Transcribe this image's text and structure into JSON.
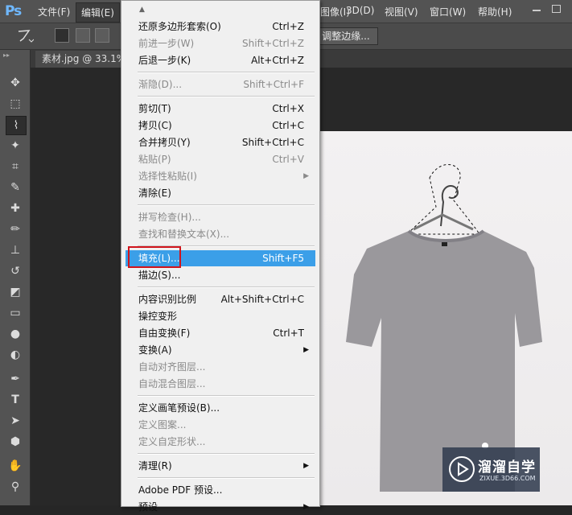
{
  "app": {
    "logo": "Ps"
  },
  "menubar": {
    "items": [
      "文件(F)",
      "编辑(E)",
      "图像(I)",
      "3D(D)",
      "视图(V)",
      "窗口(W)",
      "帮助(H)"
    ]
  },
  "options": {
    "refine_label": "调整边缘..."
  },
  "document": {
    "tab_label": "素材.jpg @ 33.1%"
  },
  "toolbar": {
    "tools": [
      "move-tool-icon",
      "marquee-tool-icon",
      "polygonal-lasso-tool-icon",
      "magic-wand-tool-icon",
      "crop-tool-icon",
      "eyedropper-tool-icon",
      "healing-brush-tool-icon",
      "brush-tool-icon",
      "clone-stamp-tool-icon",
      "history-brush-tool-icon",
      "eraser-tool-icon",
      "gradient-tool-icon",
      "blur-tool-icon",
      "dodge-tool-icon",
      "pen-tool-icon",
      "type-tool-icon",
      "path-selection-tool-icon",
      "shape-tool-icon",
      "hand-tool-icon",
      "zoom-tool-icon"
    ],
    "selected_tool": "polygonal-lasso-tool-icon"
  },
  "edit_menu": {
    "items": [
      {
        "label": "还原多边形套索(O)",
        "shortcut": "Ctrl+Z",
        "disabled": false
      },
      {
        "label": "前进一步(W)",
        "shortcut": "Shift+Ctrl+Z",
        "disabled": true
      },
      {
        "label": "后退一步(K)",
        "shortcut": "Alt+Ctrl+Z",
        "disabled": false
      },
      {
        "label": "渐隐(D)...",
        "shortcut": "Shift+Ctrl+F",
        "disabled": true
      },
      {
        "label": "剪切(T)",
        "shortcut": "Ctrl+X",
        "disabled": false
      },
      {
        "label": "拷贝(C)",
        "shortcut": "Ctrl+C",
        "disabled": false
      },
      {
        "label": "合并拷贝(Y)",
        "shortcut": "Shift+Ctrl+C",
        "disabled": false
      },
      {
        "label": "粘贴(P)",
        "shortcut": "Ctrl+V",
        "disabled": true
      },
      {
        "label": "选择性粘贴(I)",
        "shortcut": "",
        "disabled": true,
        "submenu": true
      },
      {
        "label": "清除(E)",
        "shortcut": "",
        "disabled": false
      },
      {
        "label": "拼写检查(H)...",
        "shortcut": "",
        "disabled": true
      },
      {
        "label": "查找和替换文本(X)...",
        "shortcut": "",
        "disabled": true
      },
      {
        "label": "填充(L)...",
        "shortcut": "Shift+F5",
        "disabled": false,
        "highlighted": true
      },
      {
        "label": "描边(S)...",
        "shortcut": "",
        "disabled": false
      },
      {
        "label": "内容识别比例",
        "shortcut": "Alt+Shift+Ctrl+C",
        "disabled": false
      },
      {
        "label": "操控变形",
        "shortcut": "",
        "disabled": false
      },
      {
        "label": "自由变换(F)",
        "shortcut": "Ctrl+T",
        "disabled": false
      },
      {
        "label": "变换(A)",
        "shortcut": "",
        "disabled": false,
        "submenu": true
      },
      {
        "label": "自动对齐图层...",
        "shortcut": "",
        "disabled": true
      },
      {
        "label": "自动混合图层...",
        "shortcut": "",
        "disabled": true
      },
      {
        "label": "定义画笔预设(B)...",
        "shortcut": "",
        "disabled": false
      },
      {
        "label": "定义图案...",
        "shortcut": "",
        "disabled": true
      },
      {
        "label": "定义自定形状...",
        "shortcut": "",
        "disabled": true
      },
      {
        "label": "清理(R)",
        "shortcut": "",
        "disabled": false,
        "submenu": true
      },
      {
        "label": "Adobe PDF 预设...",
        "shortcut": "",
        "disabled": false
      },
      {
        "label": "预设",
        "shortcut": "",
        "disabled": false,
        "submenu": true
      }
    ]
  },
  "watermark": {
    "title": "溜溜自学",
    "subtitle": "ZIXUE.3D66.COM"
  },
  "colors": {
    "highlight": "#3b9fe8",
    "annotation_box": "#d0141c",
    "shirt": "#9a989c"
  }
}
